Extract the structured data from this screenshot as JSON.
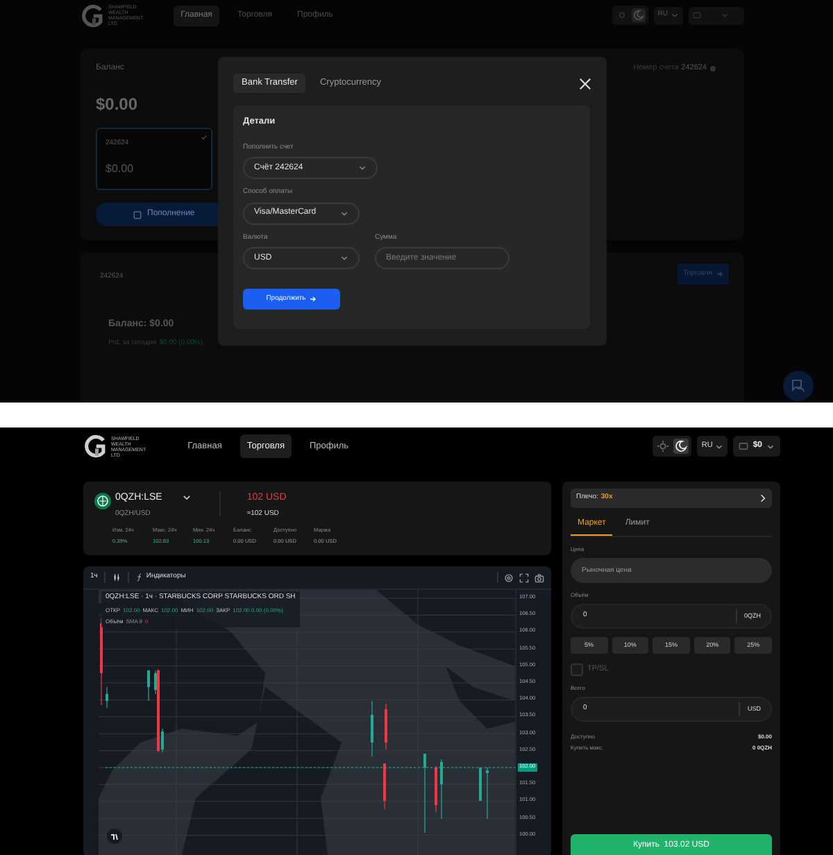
{
  "deposit_screen": {
    "header": {
      "logo_text": [
        "SHAWFIELD",
        "WEALTH",
        "MANAGEMENT",
        "LTD"
      ],
      "nav": [
        {
          "label": "Главная",
          "selected": true
        },
        {
          "label": "Торговля",
          "selected": false
        },
        {
          "label": "Профиль",
          "selected": false
        }
      ],
      "theme": [
        {
          "kind": "light",
          "selected": false
        },
        {
          "kind": "dark",
          "selected": true
        }
      ],
      "language": "RU"
    },
    "balance_card": {
      "title": "Баланс",
      "amount": "$0.00",
      "account_number_label": "Номер счета",
      "account_number": "242624",
      "account_tile": {
        "number": "242624",
        "amount": "$0.00",
        "selected": true
      },
      "deposit_button": "Пополнение"
    },
    "account_card": {
      "number": "242624",
      "trade_button": "Торговля",
      "balance": "Баланс: $0.00",
      "pnl_label": "PnL за сегодня",
      "pnl_value": "$0.00 (0.00%)"
    },
    "modal": {
      "tabs": [
        {
          "label": "Bank Transfer",
          "selected": true
        },
        {
          "label": "Cryptocurrency",
          "selected": false
        }
      ],
      "section_title": "Детали",
      "fields": [
        {
          "kind": "select",
          "label": "Пополнить счет",
          "value": "Счёт 242624"
        },
        {
          "kind": "select",
          "label": "Способ оплаты",
          "value": "Visa/MasterCard"
        },
        {
          "kind": "select",
          "label": "Валюта",
          "value": "USD"
        },
        {
          "kind": "input",
          "label": "Сумма",
          "placeholder": "Введите значение"
        }
      ],
      "submit_button": "Продолжить"
    }
  },
  "trading_screen": {
    "header": {
      "logo_text": [
        "SHAWFIELD",
        "WEALTH",
        "MANAGEMENT",
        "LTD"
      ],
      "nav": [
        {
          "label": "Главная",
          "selected": false
        },
        {
          "label": "Торговля",
          "selected": true
        },
        {
          "label": "Профиль",
          "selected": false
        }
      ],
      "theme": [
        {
          "kind": "light",
          "selected": false
        },
        {
          "kind": "dark",
          "selected": true
        }
      ],
      "language": "RU",
      "wallet": "$0"
    },
    "symbol": {
      "ticker": "0QZH:LSE",
      "pair": "0QZH/USD",
      "price": "102 USD",
      "approx": "≈102 USD",
      "stats": [
        {
          "kind": "market",
          "label": "Изм. 24ч",
          "value": "0.39%"
        },
        {
          "kind": "market",
          "label": "Макс. 24ч",
          "value": "102.83"
        },
        {
          "kind": "market",
          "label": "Мин. 24ч",
          "value": "100.13"
        },
        {
          "kind": "account",
          "label": "Баланс",
          "value": "0.00 USD"
        },
        {
          "kind": "account",
          "label": "Доступно",
          "value": "0.00 USD"
        },
        {
          "kind": "account",
          "label": "Маржа",
          "value": "0.00 USD"
        }
      ]
    },
    "chart": {
      "interval": "1ч",
      "indicators": "Индикаторы",
      "title": "0QZH:LSE · 1ч · STARBUCKS CORP STARBUCKS ORD SH",
      "ohlc": [
        {
          "label": "ОТКР",
          "value": "102.00"
        },
        {
          "label": "МАКС",
          "value": "102.00"
        },
        {
          "label": "МИН",
          "value": "102.00"
        },
        {
          "label": "ЗАКР",
          "value": "102.00 0.00 (0.00%)"
        }
      ],
      "volume_label": "Объём",
      "volume_sma": "SMA 9",
      "volume_value": "0",
      "price_axis": [
        {
          "label": "107.00",
          "current": false
        },
        {
          "label": "106.50",
          "current": false
        },
        {
          "label": "106.00",
          "current": false
        },
        {
          "label": "105.50",
          "current": false
        },
        {
          "label": "105.00",
          "current": false
        },
        {
          "label": "104.50",
          "current": false
        },
        {
          "label": "104.00",
          "current": false
        },
        {
          "label": "103.50",
          "current": false
        },
        {
          "label": "103.00",
          "current": false
        },
        {
          "label": "102.50",
          "current": false
        },
        {
          "label": "102.00",
          "current": true
        },
        {
          "label": "101.50",
          "current": false
        },
        {
          "label": "101.00",
          "current": false
        },
        {
          "label": "100.50",
          "current": false
        },
        {
          "label": "100.00",
          "current": false
        }
      ]
    },
    "order_panel": {
      "leverage_label": "Плечо:",
      "leverage_value": "30x",
      "tabs": [
        {
          "label": "Маркет",
          "selected": true
        },
        {
          "label": "Лимит",
          "selected": false
        }
      ],
      "price_label": "Цена",
      "price_placeholder": "Рыночная цена",
      "volume_label": "Объём",
      "volume_value": "0",
      "volume_unit": "0QZH",
      "percents": [
        "5%",
        "10%",
        "15%",
        "20%",
        "25%"
      ],
      "tpsl": {
        "label": "TP/SL",
        "checked": false
      },
      "total_label": "Всего",
      "total_value": "0",
      "total_unit": "USD",
      "summary": [
        {
          "label": "Доступно",
          "value": "$0.00"
        },
        {
          "label": "Купить макс.",
          "value": "0 0QZH"
        }
      ],
      "buy_button": "Купить  103.02 USD"
    }
  }
}
